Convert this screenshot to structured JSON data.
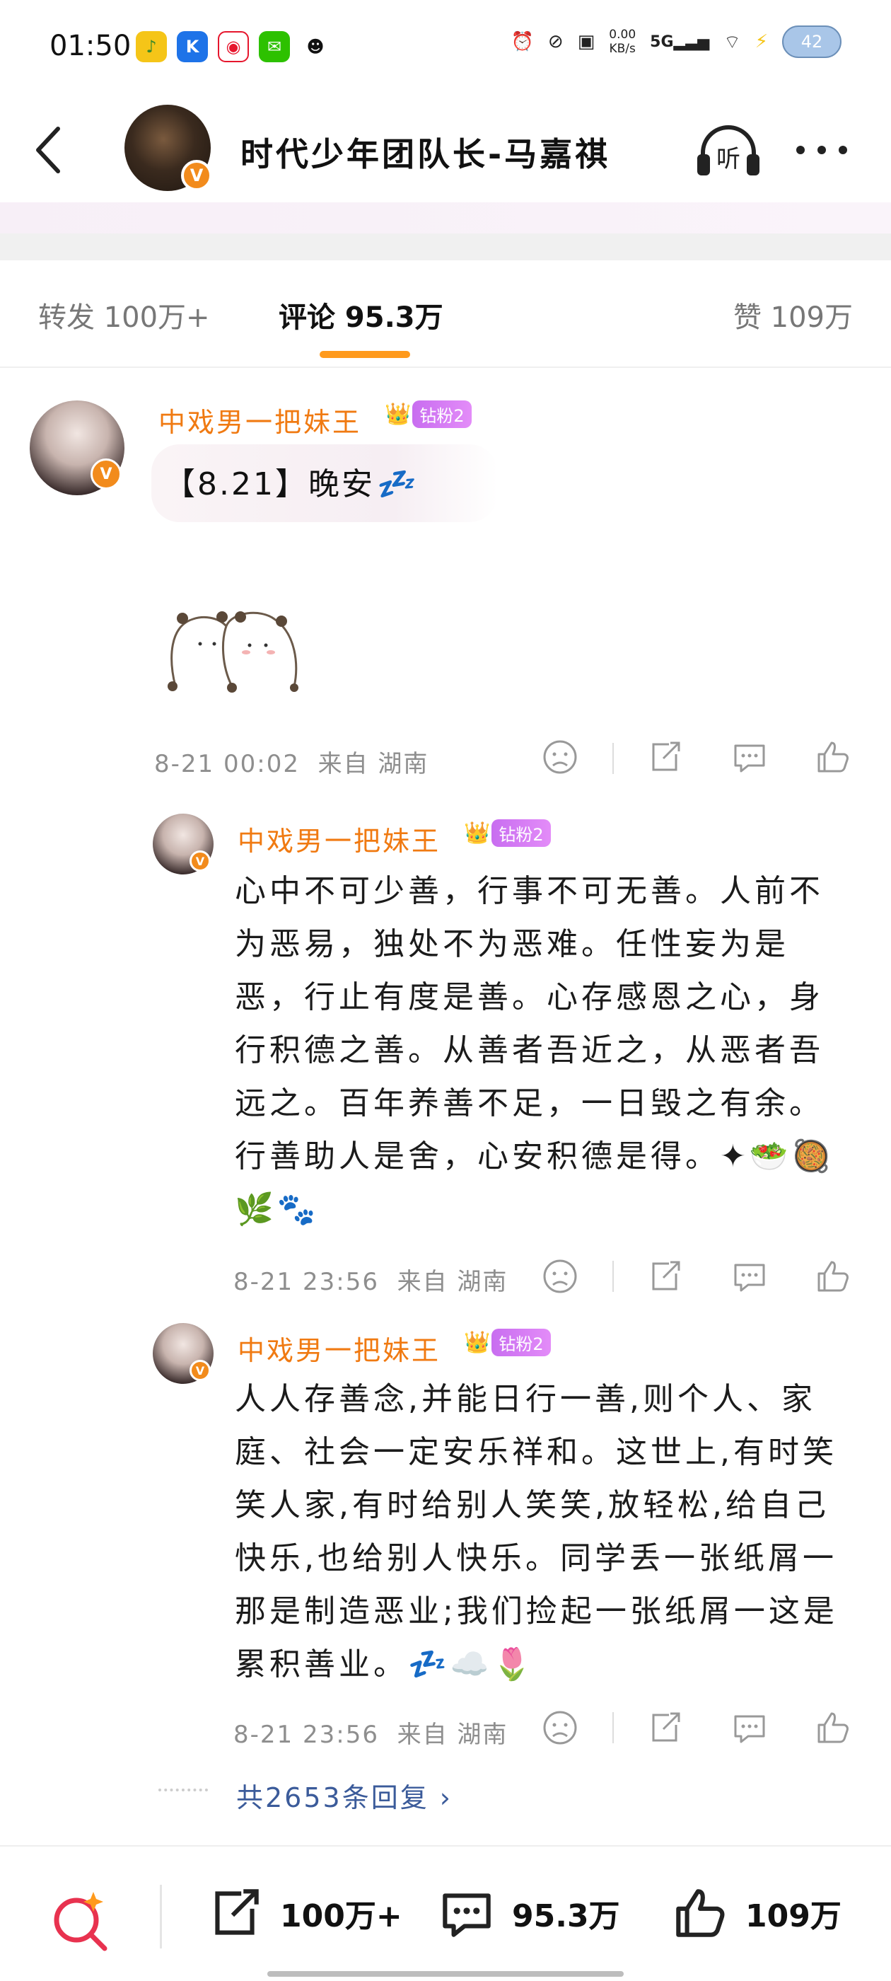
{
  "status_bar": {
    "time": "01:50",
    "net_speed_value": "0.00",
    "net_speed_unit": "KB/s",
    "network": "5G",
    "battery": "42"
  },
  "header": {
    "title": "时代少年团队长-马嘉祺",
    "listen_label": "听"
  },
  "tabs": {
    "repost": "转发 100万+",
    "comments": "评论 95.3万",
    "likes": "赞 109万"
  },
  "comments": [
    {
      "username": "中戏男一把妹王",
      "fan_badge": "钻粉2",
      "crown_level": "5",
      "text_prefix": "【8.21】晚安",
      "emoji_zzz": "💤",
      "date": "8-21 00:02",
      "location": "来自 湖南"
    }
  ],
  "replies": [
    {
      "username": "中戏男一把妹王",
      "fan_badge": "钻粉2",
      "crown_level": "5",
      "text": "心中不可少善，行事不可无善。人前不为恶易，独处不为恶难。任性妄为是恶，行止有度是善。心存感恩之心，身行积德之善。从善者吾近之，从恶者吾远之。百年养善不足，一日毁之有余。行善助人是舍，心安积德是得。✦🥗🥘🌿🐾",
      "date": "8-21 23:56",
      "location": "来自 湖南"
    },
    {
      "username": "中戏男一把妹王",
      "fan_badge": "钻粉2",
      "crown_level": "5",
      "text": "人人存善念,并能日行一善,则个人、家庭、社会一定安乐祥和。这世上,有时笑笑人家,有时给别人笑笑,放轻松,给自己快乐,也给别人快乐。同学丢一张纸屑一那是制造恶业;我们捡起一张纸屑一这是累积善业。💤☁️🌷",
      "date": "8-21 23:56",
      "location": "来自 湖南"
    }
  ],
  "more_replies": "共2653条回复 ›",
  "bottom_bar": {
    "repost_count": "100万+",
    "comment_count": "95.3万",
    "like_count": "109万"
  },
  "colors": {
    "username": "#f07a12",
    "tab_underline": "#ff9a1c",
    "link": "#3b5b9a",
    "badge": "#f28b1c"
  }
}
